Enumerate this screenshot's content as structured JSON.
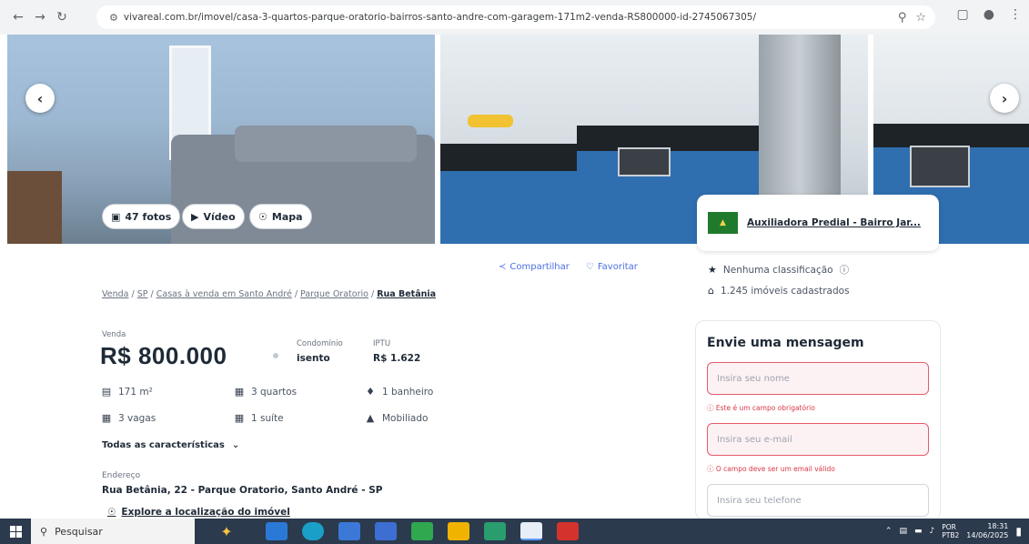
{
  "browser": {
    "url": "vivareal.com.br/imovel/casa-3-quartos-parque-oratorio-bairros-santo-andre-com-garagem-171m2-venda-RS800000-id-2745067305/"
  },
  "gallery": {
    "photos_button": "47 fotos",
    "video_button": "Vídeo",
    "map_button": "Mapa"
  },
  "actions": {
    "share": "Compartilhar",
    "favorite": "Favoritar"
  },
  "breadcrumb": {
    "items": [
      "Venda",
      "SP",
      "Casas à venda em Santo André",
      "Parque Oratorio"
    ],
    "current": "Rua Betânia"
  },
  "listing": {
    "price_label": "Venda",
    "price": "R$ 800.000",
    "condo_label": "Condomínio",
    "condo_value": "isento",
    "iptu_label": "IPTU",
    "iptu_value": "R$ 1.622",
    "features": {
      "area": "171 m²",
      "bedrooms": "3 quartos",
      "bathrooms": "1 banheiro",
      "parking": "3 vagas",
      "suites": "1 suíte",
      "furnished": "Mobiliado"
    },
    "all_features_link": "Todas as características",
    "address_label": "Endereço",
    "address": "Rua Betânia, 22 - Parque Oratorio, Santo André - SP",
    "explore_link": "Explore a localização do imóvel"
  },
  "agency": {
    "name": "Auxiliadora Predial - Bairro Jar...",
    "rating": "Nenhuma classificação",
    "listings": "1.245 imóveis cadastrados"
  },
  "contact_form": {
    "title": "Envie uma mensagem",
    "name_placeholder": "Insira seu nome",
    "name_error": "Este é um campo obrigatório",
    "email_placeholder": "Insira seu e-mail",
    "email_error": "O campo deve ser um email válido",
    "phone_placeholder": "Insira seu telefone"
  },
  "taskbar": {
    "search_placeholder": "Pesquisar",
    "language_top": "POR",
    "language_bottom": "PTB2",
    "time": "18:31",
    "date": "14/06/2025"
  }
}
